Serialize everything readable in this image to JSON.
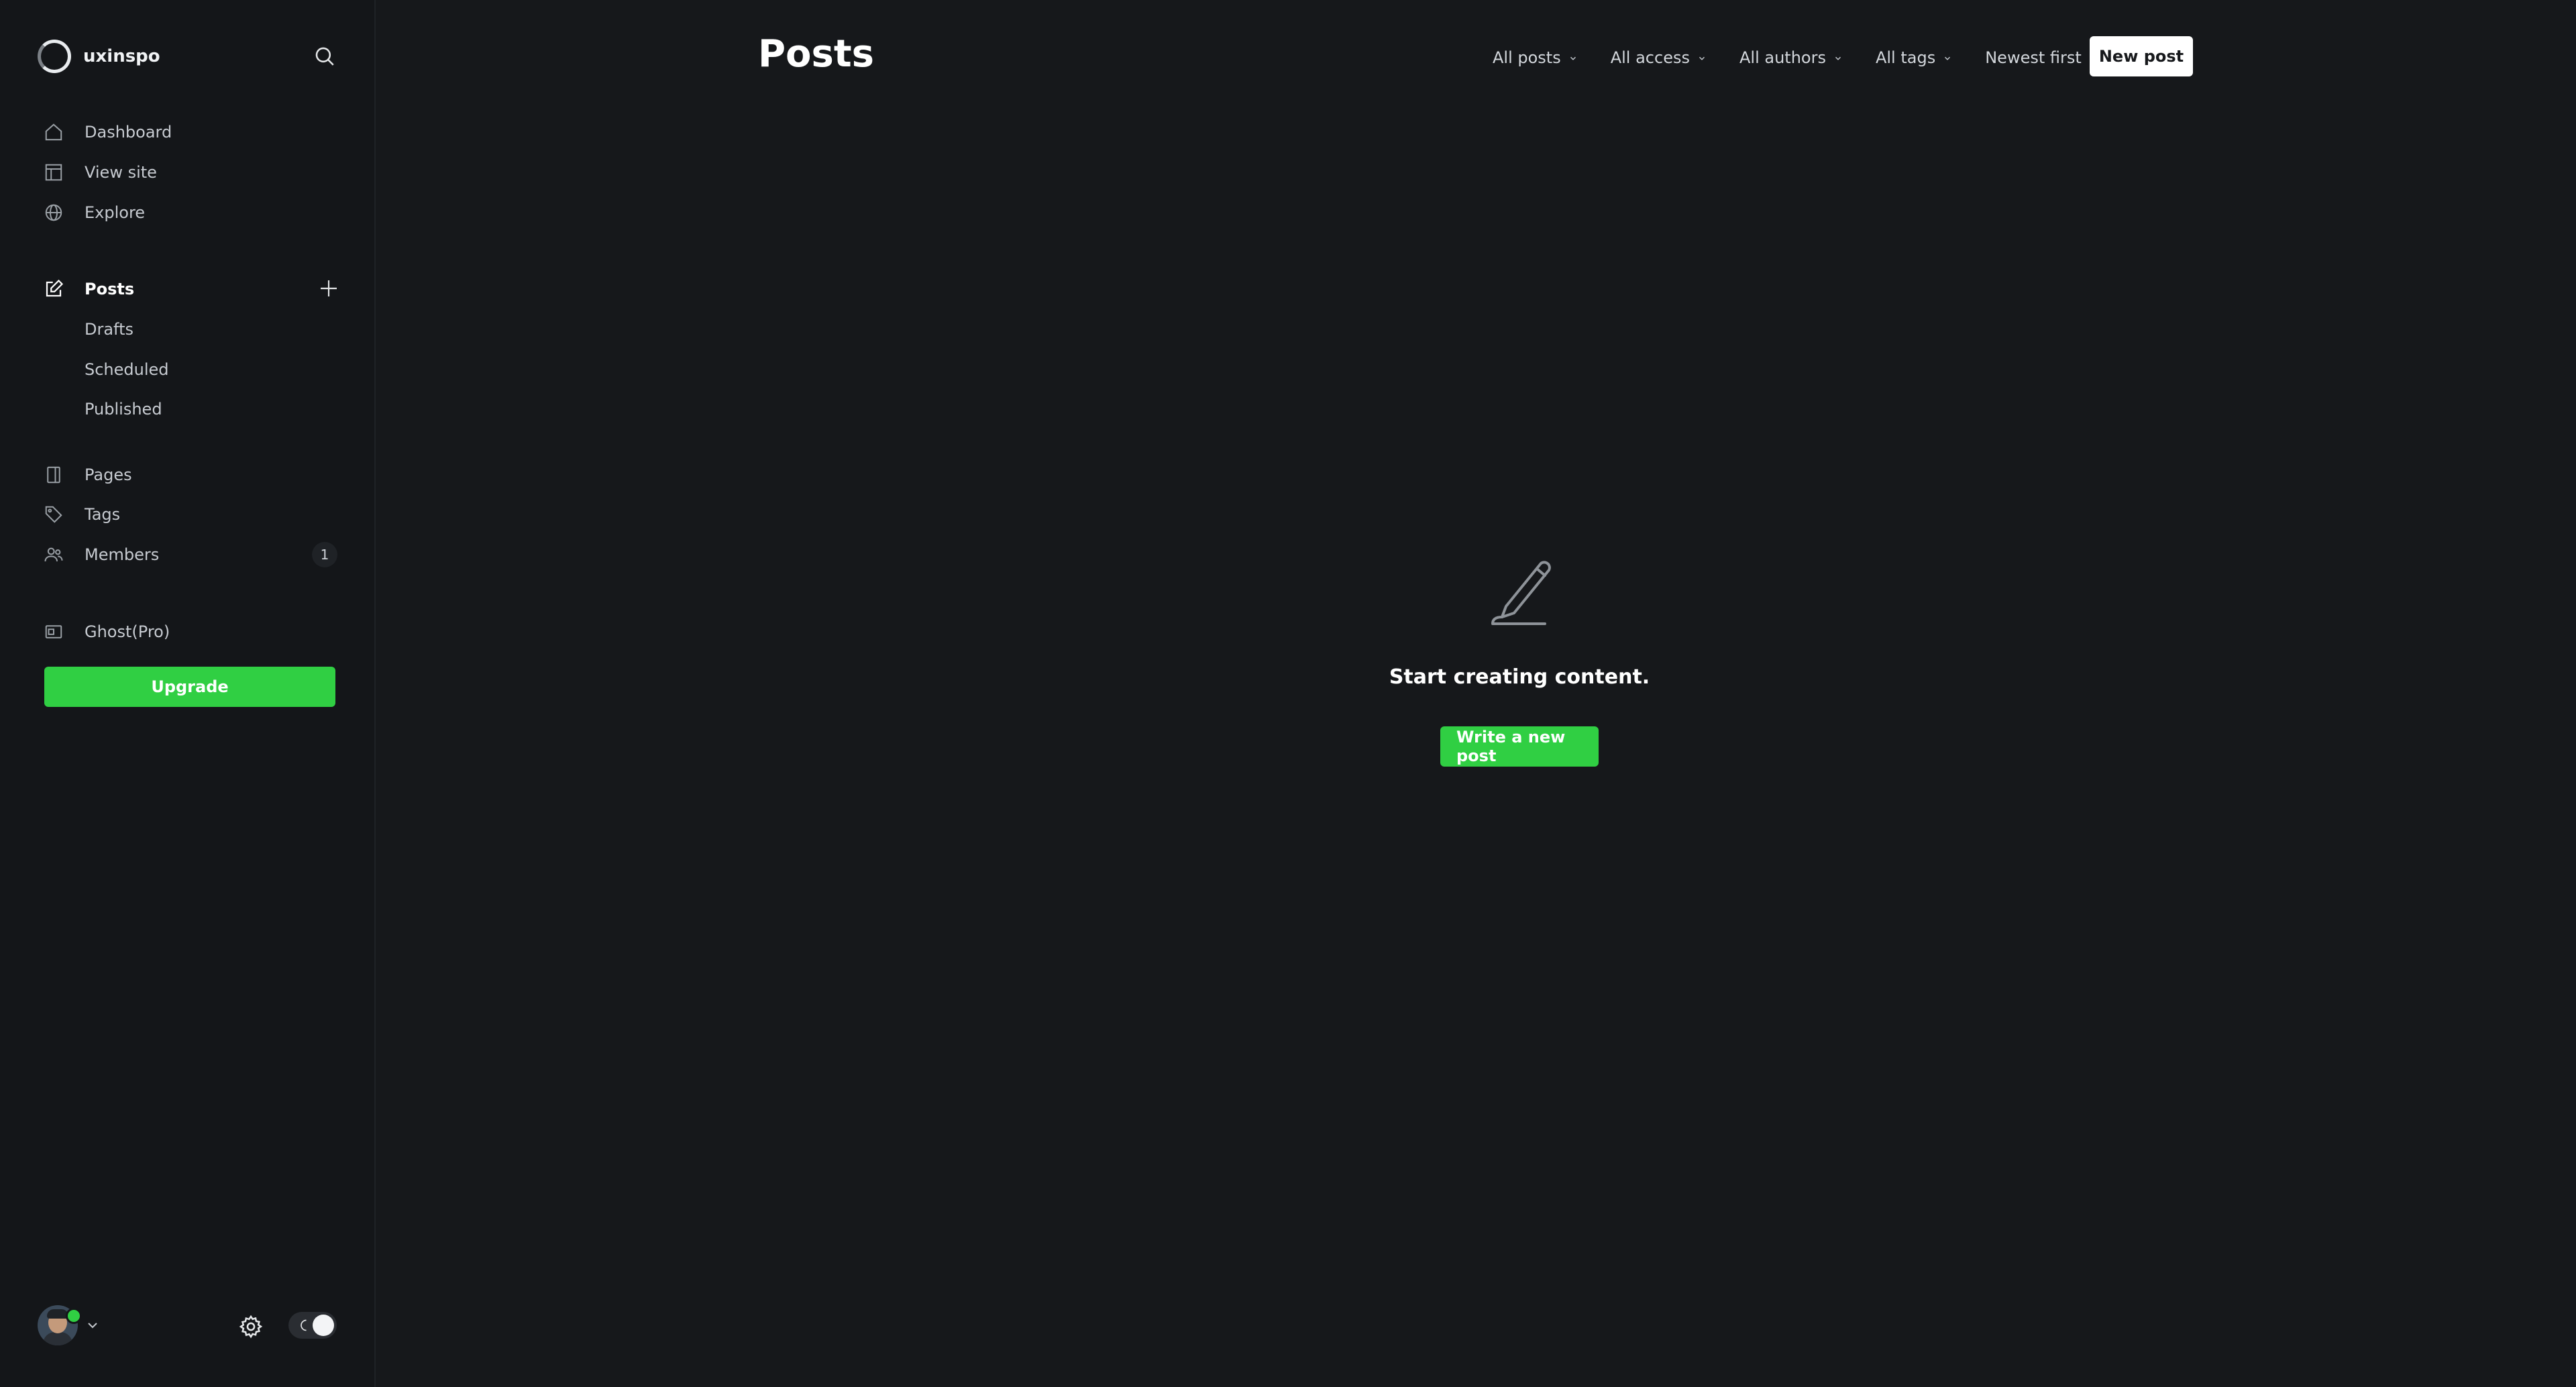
{
  "brand": {
    "name": "uxinspo"
  },
  "sidebar": {
    "nav_top": [
      {
        "label": "Dashboard",
        "icon": "home-icon"
      },
      {
        "label": "View site",
        "icon": "layout-icon"
      },
      {
        "label": "Explore",
        "icon": "globe-icon"
      }
    ],
    "posts": {
      "label": "Posts",
      "icon": "edit-icon",
      "sub": [
        "Drafts",
        "Scheduled",
        "Published"
      ]
    },
    "nav_mid": [
      {
        "label": "Pages",
        "icon": "page-icon"
      },
      {
        "label": "Tags",
        "icon": "tag-icon"
      },
      {
        "label": "Members",
        "icon": "members-icon",
        "count": "1"
      }
    ],
    "ghost_pro": {
      "label": "Ghost(Pro)",
      "icon": "credit-card-icon"
    },
    "upgrade_label": "Upgrade"
  },
  "header": {
    "title": "Posts",
    "filters": [
      "All posts",
      "All access",
      "All authors",
      "All tags",
      "Newest first"
    ],
    "new_post_label": "New post"
  },
  "empty_state": {
    "title": "Start creating content.",
    "button_label": "Write a new post",
    "icon": "pencil-icon"
  },
  "colors": {
    "background": "#16181b",
    "sidebar": "#141619",
    "accent": "#30cf43"
  }
}
